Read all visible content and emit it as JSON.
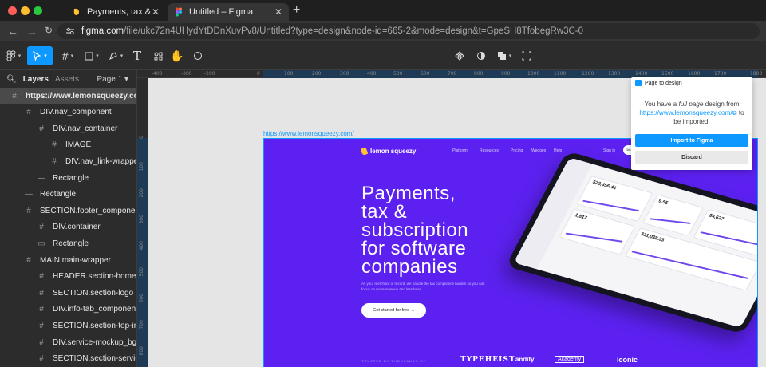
{
  "browser": {
    "tabs": [
      {
        "title": "Payments, tax & subscription"
      },
      {
        "title": "Untitled – Figma"
      }
    ],
    "url_host": "figma.com",
    "url_rest": "/file/ukc72n4UHydYtDDnXuvPv8/Untitled?type=design&node-id=665-2&mode=design&t=GpeSH8TfobegRw3C-0"
  },
  "toolbar": {
    "main_menu_icon": "figma-icon",
    "move_tool_icon": "cursor-icon",
    "frame_tool_icon": "hash-icon",
    "shape_tool_icon": "square-icon",
    "pen_tool_icon": "pen-icon",
    "text_tool_icon": "text-icon",
    "resources_icon": "grid-icon",
    "hand_tool_icon": "hand-icon",
    "comment_tool_icon": "comment-icon",
    "component_icon": "component-icon",
    "mask_icon": "contrast-icon",
    "boolean_icon": "union-icon",
    "crop_icon": "crop-icon",
    "accent_color": "#0d99ff"
  },
  "layers_panel": {
    "tab_layers": "Layers",
    "tab_assets": "Assets",
    "page": "Page 1",
    "items": [
      {
        "label": "https://www.lemonsqueezy.com/",
        "icon": "#"
      },
      {
        "label": "DIV.nav_component",
        "icon": "#"
      },
      {
        "label": "DIV.nav_container",
        "icon": "#"
      },
      {
        "label": "IMAGE",
        "icon": "#"
      },
      {
        "label": "DIV.nav_link-wrapper",
        "icon": "#"
      },
      {
        "label": "Rectangle",
        "icon": "—"
      },
      {
        "label": "Rectangle",
        "icon": "—"
      },
      {
        "label": "SECTION.footer_component",
        "icon": "#"
      },
      {
        "label": "DIV.container",
        "icon": "#"
      },
      {
        "label": "Rectangle",
        "icon": "▭"
      },
      {
        "label": "MAIN.main-wrapper",
        "icon": "#"
      },
      {
        "label": "HEADER.section-home-header",
        "icon": "#"
      },
      {
        "label": "SECTION.section-logo",
        "icon": "#"
      },
      {
        "label": "DIV.info-tab_component",
        "icon": "#"
      },
      {
        "label": "SECTION.section-top-intro",
        "icon": "#"
      },
      {
        "label": "DIV.service-mockup_bg-wrap...",
        "icon": "#"
      },
      {
        "label": "SECTION.section-service-cards",
        "icon": "#"
      }
    ]
  },
  "rulers": {
    "top": [
      "-400",
      "-300",
      "-200",
      "0",
      "100",
      "200",
      "300",
      "400",
      "500",
      "600",
      "700",
      "800",
      "900",
      "1000",
      "1100",
      "1200",
      "1300",
      "1400",
      "1500",
      "1600",
      "1700",
      "1800"
    ],
    "left": [
      "0",
      "100",
      "200",
      "300",
      "400",
      "500",
      "600",
      "700",
      "800"
    ]
  },
  "canvas": {
    "frame_label": "https://www.lemonsqueezy.com/",
    "site": {
      "logo": "lemon squeezy",
      "nav": [
        "Platform",
        "Resources",
        "Pricing",
        "Wedges",
        "Help"
      ],
      "sign_in": "Sign in",
      "get_started_small": "Get",
      "hero_line1": "Payments,",
      "hero_line2": "tax &",
      "hero_line3": "subscription",
      "hero_line4": "for software",
      "hero_line5": "companies",
      "subtext": "As your merchant of record, we handle the tax compliance burden so you can focus on more revenue and less head...",
      "cta": "Get started for free →",
      "trusted": "TRUSTED BY THOUSANDS OF",
      "brands": [
        "TYPEHEIST",
        "Landify",
        "Academy",
        "iconic"
      ],
      "dash_value1": "$23,456.44",
      "dash_value2": "9.55",
      "dash_value3": "$4,627",
      "dash_value4": "1,817",
      "dash_value5": "$11,038.33",
      "bg_color": "#5c21f0"
    }
  },
  "plugin": {
    "title": "Page to design",
    "message_pre": "You have a ",
    "message_em": "full page",
    "message_mid": " design from ",
    "message_link": "https://www.lemonsqueezy.com/",
    "message_post": " to be imported.",
    "import_button": "Import to Figma",
    "discard_button": "Discard"
  }
}
